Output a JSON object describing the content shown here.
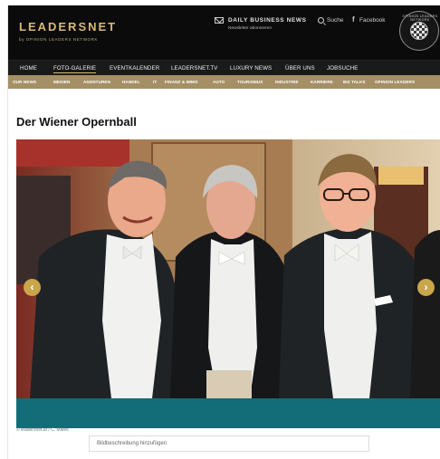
{
  "header": {
    "logo_text": "LEADERSNET",
    "logo_subtitle": "by OPINION LEADERS NETWORK",
    "newsletter_title": "DAILY BUSINESS NEWS",
    "newsletter_subtitle": "Newsletter abonnieren",
    "search_label": "Suche",
    "facebook_label": "Facebook",
    "seal_text": "OPINION LEADERS NETWORK",
    "icons": [
      "mail-icon",
      "search-icon",
      "facebook-icon"
    ]
  },
  "main_nav": {
    "items": [
      "HOME",
      "FOTO-GALERIE",
      "EVENTKALENDER",
      "LEADERSNET.TV",
      "LUXURY NEWS",
      "ÜBER UNS",
      "JOBSUCHE"
    ],
    "active": "FOTO-GALERIE"
  },
  "sub_nav": {
    "items": [
      "OUR NEWS",
      "MEDIEN",
      "AGENTUREN",
      "HANDEL",
      "IT",
      "FINANZ & IMMO",
      "AUTO",
      "TOURISMUS",
      "INDUSTRIE",
      "KARRIERE",
      "BIZ TALKS",
      "OPINION LEADERS"
    ]
  },
  "gallery": {
    "title": "Der Wiener Opernball",
    "prev_arrow": "‹",
    "next_arrow": "›",
    "credit": "© leadersnet.at / C. Mikes",
    "description_placeholder": "Bildbeschreibung hinzufügen"
  },
  "colors": {
    "header_bg": "#0b0b0b",
    "gold": "#d8b978",
    "subnav_bg": "#a59065",
    "teal": "#136d78",
    "arrow": "#c9a64a"
  }
}
